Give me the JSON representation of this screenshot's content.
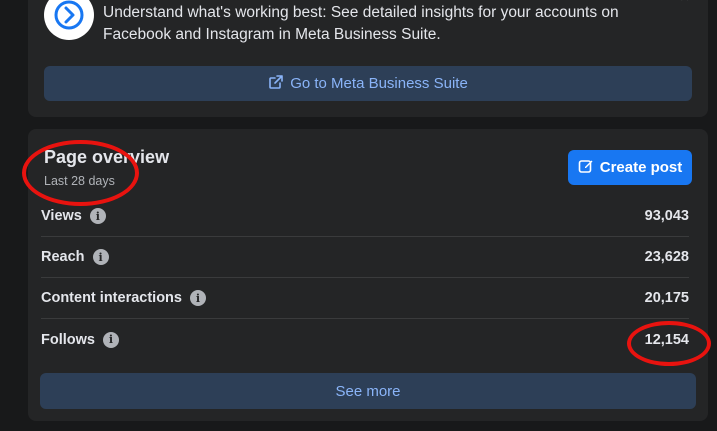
{
  "banner": {
    "text": "Understand what's working best: See detailed insights for your accounts on Facebook and Instagram in Meta Business Suite.",
    "button_label": "Go to Meta Business Suite",
    "close_glyph": "×"
  },
  "overview": {
    "title": "Page overview",
    "subtitle": "Last 28 days",
    "create_post_label": "Create post",
    "metrics": [
      {
        "label": "Views",
        "value": "93,043"
      },
      {
        "label": "Reach",
        "value": "23,628"
      },
      {
        "label": "Content interactions",
        "value": "20,175"
      },
      {
        "label": "Follows",
        "value": "12,154"
      }
    ],
    "see_more_label": "See more"
  },
  "colors": {
    "background": "#18191a",
    "card": "#242526",
    "accent": "#1877f2",
    "link": "#8ab4f8",
    "annotation": "#e8130f"
  }
}
